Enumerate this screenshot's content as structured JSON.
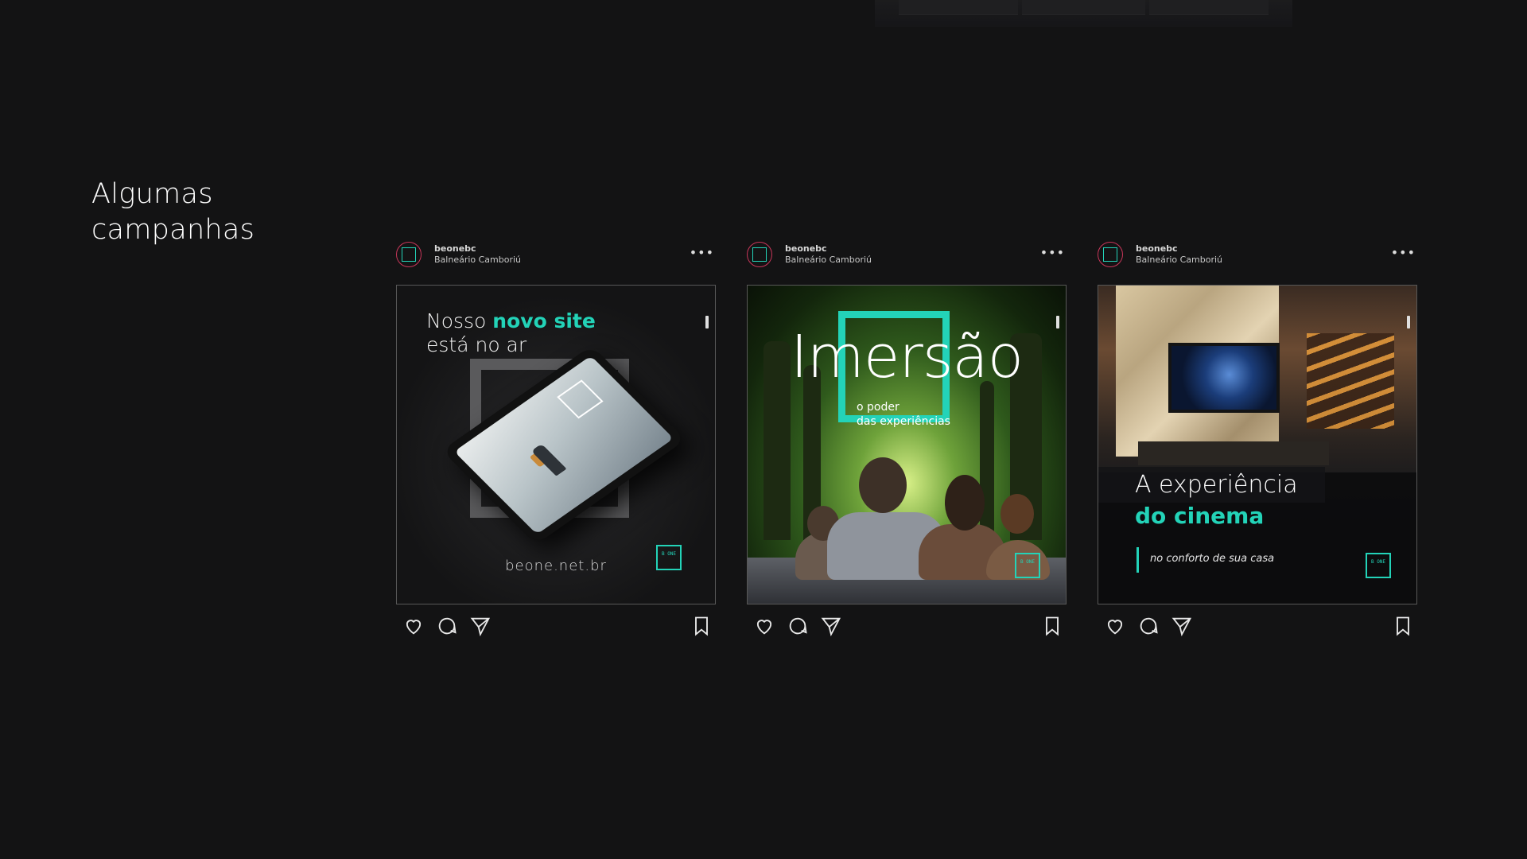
{
  "section": {
    "title": "Algumas campanhas"
  },
  "colors": {
    "background": "#131314",
    "accent": "#23d3b8",
    "avatar_ring": "#c9365a"
  },
  "posts": [
    {
      "username": "beonebc",
      "location": "Balneário Camboriú",
      "more_icon": "more-dots-icon",
      "headline_line1": "Nosso",
      "headline_highlight": "novo site",
      "headline_line2": "está no ar",
      "url": "beone.net.br",
      "brand_mark": "B ONE"
    },
    {
      "username": "beonebc",
      "location": "Balneário Camboriú",
      "more_icon": "more-dots-icon",
      "headline": "Imersão",
      "subtitle_line1": "o poder",
      "subtitle_line2": "das experiências",
      "brand_mark": "B ONE"
    },
    {
      "username": "beonebc",
      "location": "Balneário Camboriú",
      "more_icon": "more-dots-icon",
      "headline_line1": "A experiência",
      "headline_highlight": "do cinema",
      "subtitle": "no conforto de sua casa",
      "brand_mark": "B ONE"
    }
  ],
  "action_icons": [
    "heart-icon",
    "comment-icon",
    "send-icon",
    "bookmark-icon"
  ]
}
